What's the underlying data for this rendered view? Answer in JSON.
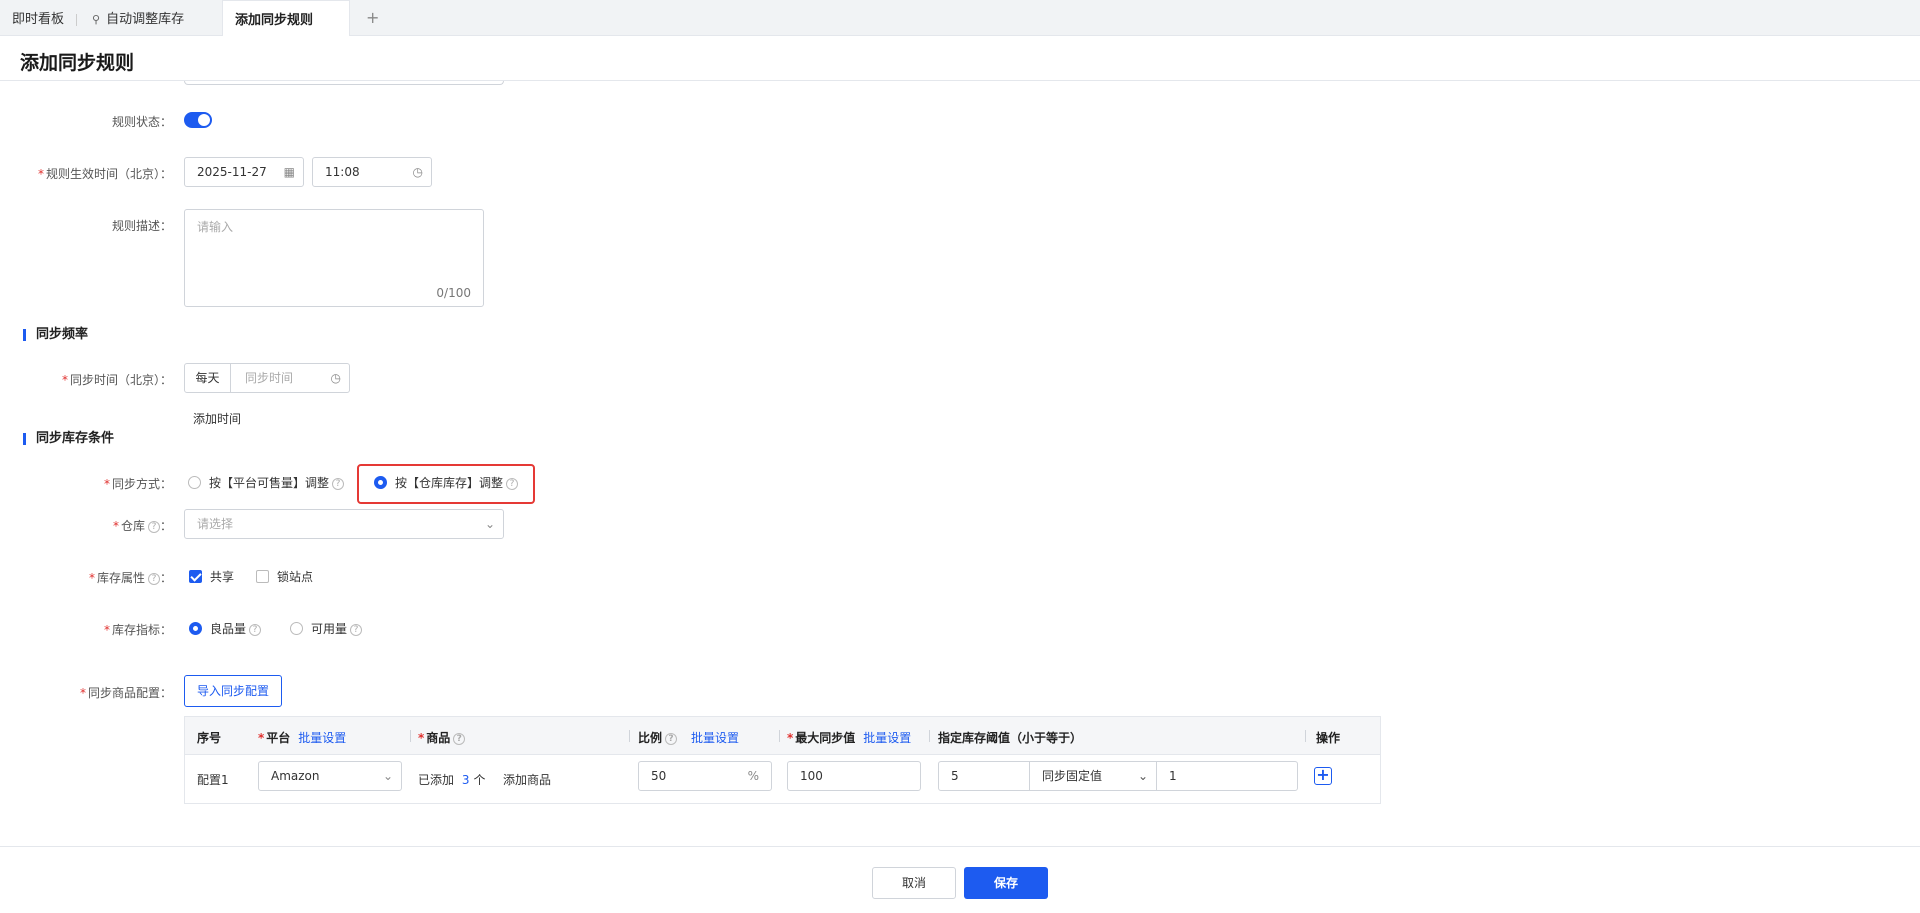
{
  "tabs": [
    {
      "label": "即时看板"
    },
    {
      "label": "自动调整库存"
    },
    {
      "label": "添加同步规则"
    }
  ],
  "tab_add": "+",
  "page_title": "添加同步规则",
  "form": {
    "rule_status_label": "规则状态：",
    "effective_time_label": "规则生效时间（北京）：",
    "effective_date": "2025-11-27",
    "effective_time": "11:08",
    "description_label": "规则描述：",
    "description_placeholder": "请输入",
    "description_count": "0/100"
  },
  "sync_frequency": {
    "section_title": "同步频率",
    "sync_time_label": "同步时间（北京）：",
    "freq_value": "每天",
    "time_placeholder": "同步时间",
    "add_time_link": "添加时间"
  },
  "sync_conditions": {
    "section_title": "同步库存条件",
    "method_label": "同步方式：",
    "method_option1": "按【平台可售量】调整",
    "method_option2": "按【仓库库存】调整",
    "warehouse_label": "仓库",
    "warehouse_suffix": "：",
    "warehouse_placeholder": "请选择",
    "attr_label": "库存属性",
    "attr_suffix": "：",
    "attr_shared": "共享",
    "attr_locked": "锁站点",
    "indicator_label": "库存指标：",
    "indicator_good": "良品量",
    "indicator_available": "可用量",
    "product_config_label": "同步商品配置：",
    "import_button": "导入同步配置"
  },
  "table": {
    "headers": {
      "index": "序号",
      "platform": "平台",
      "batch1": "批量设置",
      "product": "商品",
      "ratio": "比例",
      "batch2": "批量设置",
      "max_sync": "最大同步值",
      "batch3": "批量设置",
      "threshold": "指定库存阈值（小于等于）",
      "ops": "操作"
    },
    "row": {
      "index": "配置1",
      "platform": "Amazon",
      "added_prefix": "已添加",
      "added_count": "3",
      "added_suffix": "个",
      "add_product": "添加商品",
      "ratio": "50",
      "ratio_unit": "%",
      "max_sync": "100",
      "threshold": "5",
      "threshold_mode": "同步固定值",
      "fixed_value": "1"
    }
  },
  "footer": {
    "cancel": "取消",
    "save": "保存"
  },
  "colors": {
    "accent": "#1d5bf0",
    "required": "#e0302e",
    "highlight": "#e53935"
  }
}
